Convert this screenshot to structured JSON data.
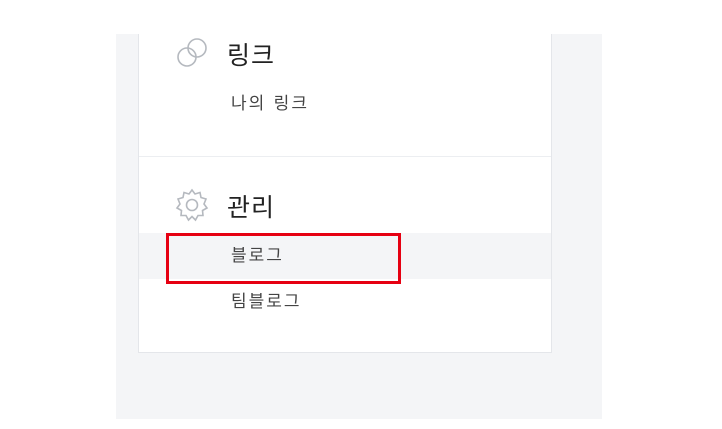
{
  "sections": [
    {
      "title": "링크",
      "icon": "link-icon",
      "items": [
        {
          "label": "나의 링크"
        }
      ]
    },
    {
      "title": "관리",
      "icon": "gear-icon",
      "items": [
        {
          "label": "블로그",
          "active": true
        },
        {
          "label": "팀블로그"
        }
      ]
    }
  ],
  "colors": {
    "highlight": "#e60012",
    "active_background": "#f4f5f7",
    "panel_border": "#e4e6ea"
  }
}
